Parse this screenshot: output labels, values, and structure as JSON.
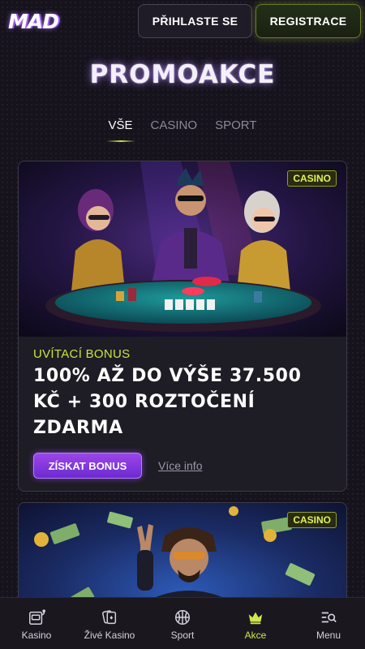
{
  "header": {
    "logo": "MAD",
    "login_label": "PŘIHLASTE SE",
    "register_label": "REGISTRACE"
  },
  "page": {
    "title": "PROMOAKCE",
    "tabs": [
      {
        "label": "VŠE",
        "active": true
      },
      {
        "label": "CASINO",
        "active": false
      },
      {
        "label": "SPORT",
        "active": false
      }
    ]
  },
  "promos": [
    {
      "badge": "CASINO",
      "subtitle": "UVÍTACÍ BONUS",
      "title": "100% AŽ DO VÝŠE 37.500 KČ + 300 ROZTOČENÍ ZDARMA",
      "cta_label": "ZÍSKAT BONUS",
      "more_label": "Více info"
    },
    {
      "badge": "CASINO"
    }
  ],
  "bottom_nav": [
    {
      "label": "Kasino",
      "icon": "slot-machine-icon",
      "active": false
    },
    {
      "label": "Živé Kasino",
      "icon": "cards-icon",
      "active": false
    },
    {
      "label": "Sport",
      "icon": "basketball-icon",
      "active": false
    },
    {
      "label": "Akce",
      "icon": "crown-icon",
      "active": true
    },
    {
      "label": "Menu",
      "icon": "menu-search-icon",
      "active": false
    }
  ],
  "colors": {
    "background": "#16131d",
    "accent_green": "#cde84a",
    "accent_purple": "#8a3de0"
  }
}
